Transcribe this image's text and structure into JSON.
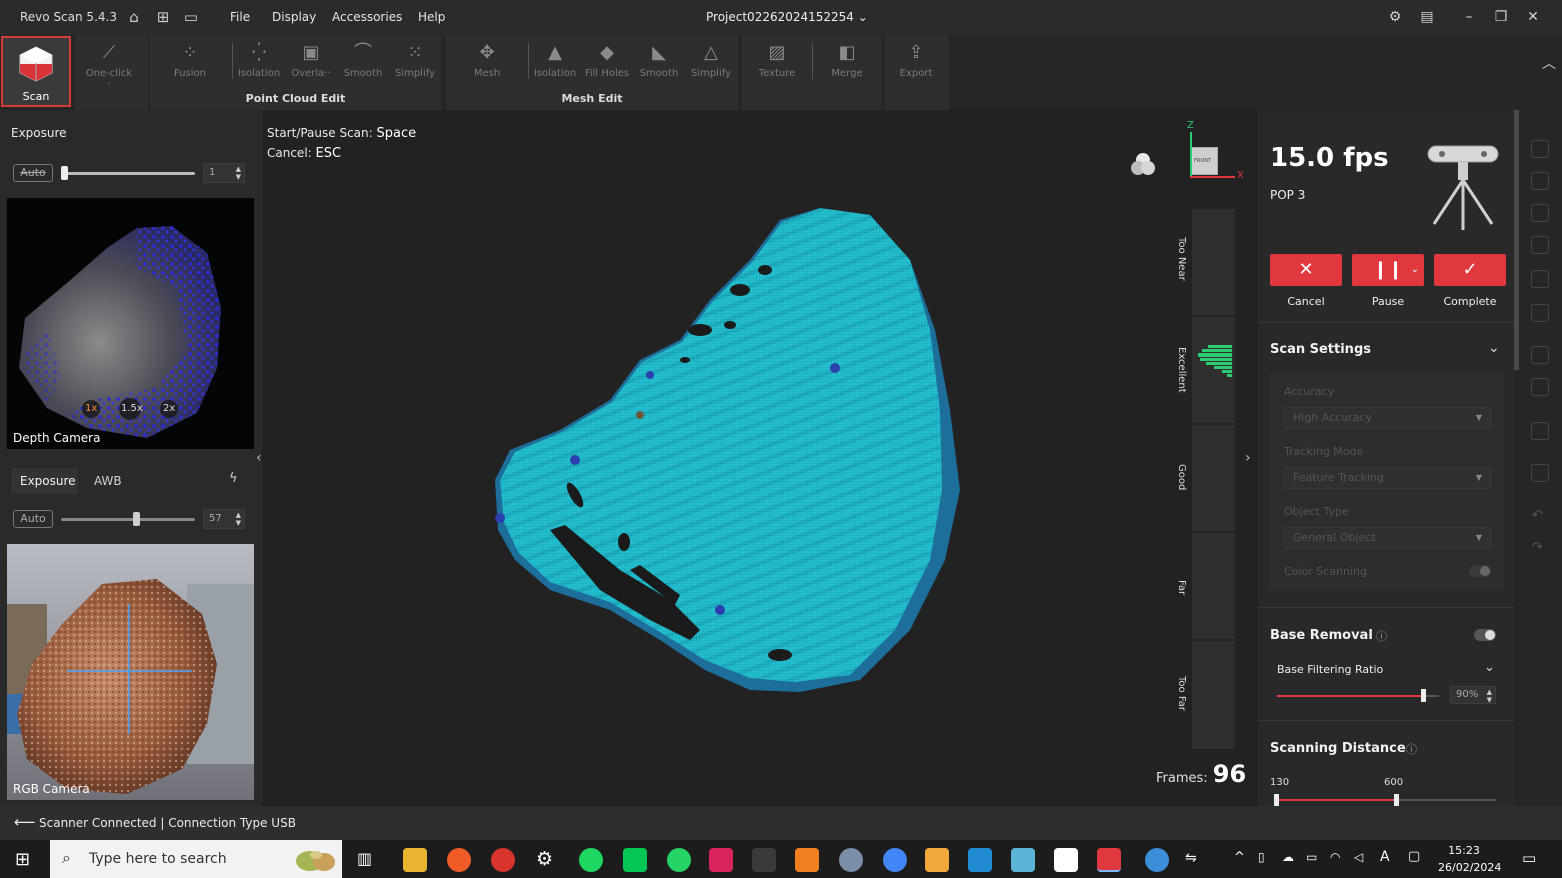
{
  "window": {
    "app_title": "Revo Scan 5.4.3",
    "project_name": "Project02262024152254",
    "menu": [
      "File",
      "Display",
      "Accessories",
      "Help"
    ]
  },
  "toolbar": {
    "scan_label": "Scan",
    "point_cloud_group": "Point Cloud Edit",
    "mesh_group": "Mesh Edit",
    "tools": {
      "one_click": "One-click ·",
      "fusion": "Fusion",
      "pc_isolation": "Isolation",
      "overlap": "Overla··",
      "pc_smooth": "Smooth",
      "pc_simplify": "Simplify",
      "mesh": "Mesh",
      "mesh_isolation": "Isolation",
      "fill_holes": "Fill Holes",
      "mesh_smooth": "Smooth",
      "mesh_simplify": "Simplify",
      "texture": "Texture",
      "merge": "Merge",
      "export": "Export"
    }
  },
  "left_panel": {
    "depth": {
      "exposure_title": "Exposure",
      "auto_label": "Auto",
      "exposure_value": "1",
      "zoom_levels": [
        "1x",
        "1.5x",
        "2x"
      ],
      "camera_label": "Depth Camera"
    },
    "rgb": {
      "tab_exposure": "Exposure",
      "tab_awb": "AWB",
      "auto_label": "Auto",
      "exposure_value": "57",
      "camera_label": "RGB Camera"
    }
  },
  "viewport": {
    "hint_start_label": "Start/Pause Scan:",
    "hint_start_key": "Space",
    "hint_cancel_label": "Cancel:",
    "hint_cancel_key": "ESC",
    "axis_z": "Z",
    "axis_x": "X",
    "axis_face": "FRONT",
    "gauge_labels": [
      "Too Near",
      "Excellent",
      "Good",
      "Far",
      "Too Far"
    ],
    "frames_label": "Frames:",
    "frames_value": "96"
  },
  "right_panel": {
    "fps": "15.0 fps",
    "device": "POP 3",
    "cancel_label": "Cancel",
    "pause_label": "Pause",
    "complete_label": "Complete",
    "scan_settings_title": "Scan Settings",
    "accuracy_label": "Accuracy",
    "accuracy_value": "High Accuracy",
    "tracking_label": "Tracking Mode",
    "tracking_value": "Feature Tracking",
    "object_label": "Object Type",
    "object_value": "General Object",
    "color_label": "Color Scanning",
    "base_removal_title": "Base Removal",
    "base_filter_label": "Base Filtering Ratio",
    "base_filter_value": "90%",
    "base_filter_fraction": 0.9,
    "scan_distance_title": "Scanning Distance",
    "distance_min": "130",
    "distance_max": "600"
  },
  "status": {
    "text": "Scanner Connected | Connection Type USB"
  },
  "taskbar": {
    "search_placeholder": "Type here to search",
    "time": "15:23",
    "date": "26/02/2024"
  },
  "colors": {
    "accent_red": "#e0383e",
    "point_cloud": "#1fb5c4",
    "gauge_green": "#2ecc71"
  }
}
